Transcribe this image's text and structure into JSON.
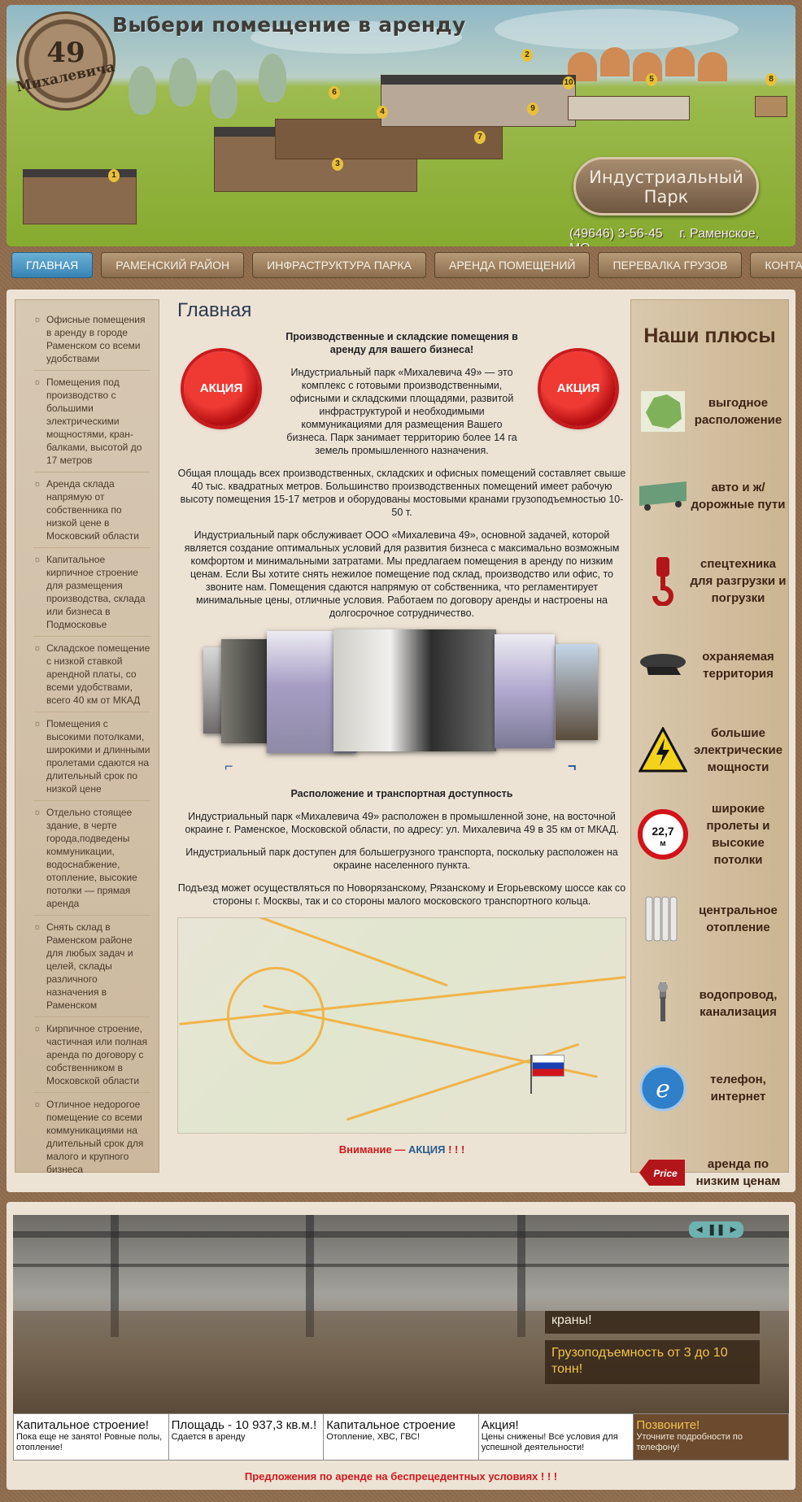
{
  "header": {
    "title": "Выбери помещение в аренду",
    "logo_number": "49",
    "logo_street": "Михалевича",
    "park_line1": "Индустриальный",
    "park_line2": "Парк",
    "phone": "(49646) 3-56-45",
    "city": "г. Раменское, МО",
    "pins": [
      "1",
      "2",
      "3",
      "4",
      "5",
      "6",
      "7",
      "8",
      "9",
      "10"
    ]
  },
  "nav": {
    "items": [
      {
        "label": "ГЛАВНАЯ",
        "active": true
      },
      {
        "label": "РАМЕНСКИЙ РАЙОН"
      },
      {
        "label": "ИНФРАСТРУКТУРА ПАРКА"
      },
      {
        "label": "АРЕНДА ПОМЕЩЕНИЙ"
      },
      {
        "label": "ПЕРЕВАЛКА ГРУЗОВ"
      },
      {
        "label": "КОНТАКТЫ"
      }
    ]
  },
  "sidebar": {
    "items": [
      "Офисные помещения в аренду в городе Раменском со всеми удобствами",
      "Помещения под производство с большими электрическими мощностями, кран-балками, высотой до 17 метров",
      "Аренда склада напрямую от собственника по низкой цене в Московский области",
      "Капитальное кирпичное строение для размещения производства, склада или бизнеса в Подмосковье",
      "Складское помещение с низкой ставкой арендной платы, со всеми удобствами, всего 40 км от МКАД",
      "Помещения с высокими потолками, широкими и длинными пролетами сдаются на длительный срок по низкой цене",
      "Отдельно стоящее здание, в черте города,подведены коммуникации, водоснабжение, отопление, высокие потолки — прямая аренда",
      "Снять склад в Раменском районе для любых задач и целей, склады различного назначения в Раменском",
      "Кирпичное строение, частичная или полная аренда по договору с собственником в Московской области",
      "Отличное недорогое помещение со всеми коммуникациями на длительный срок для малого и крупного бизнеса"
    ]
  },
  "main": {
    "title": "Главная",
    "stamp_label": "АКЦИЯ",
    "intro_heading": "Производственные и складские помещения в аренду для вашего бизнеса!",
    "intro_text": "Индустриальный парк «Михалевича 49» — это комплекс с готовыми производственными, офисными и складскими площадями, развитой инфраструктурой и необходимыми коммуникациями для размещения Вашего бизнеса. Парк занимает территорию  более 14 га земель промышленного назначения.",
    "para2": "Общая площадь всех производственных, складских и офисных помещений составляет свыше 40 тыс. квадратных метров. Большинство производственных помещений имеет рабочую высоту помещения 15-17 метров и оборудованы мостовыми кранами грузоподъемностью 10-50 т.",
    "para3": "Индустриальный парк обслуживает ООО «Михалевича 49», основной задачей, которой является создание оптимальных условий для развития бизнеса с максимально возможным комфортом и минимальными затратами. Мы предлагаем помещения в аренду по низким ценам. Если Вы хотите снять нежилое помещение под склад, производство или офис, то звоните нам. Помещения сдаются напрямую от собственника, что регламентирует минимальные цены, отличные условия. Работаем по договору аренды и настроены на долгосрочное сотрудничество.",
    "gallery_prev": "⌐",
    "gallery_next": "¬",
    "location_heading": "Расположение и транспортная доступность",
    "loc1": "Индустриальный парк «Михалевича 49» расположен в промышленной зоне, на восточной окраине г. Раменское, Московской области, по адресу: ул. Михалевича 49 в 35 км от МКАД.",
    "loc2": "Индустриальный парк доступен для большегрузного транспорта, поскольку расположен на окраине населенного пункта.",
    "loc3": "Подъезд может осуществляться по Новорязанскому, Рязанскому и Егорьевскому шоссе как со стороны г. Москвы, так и со стороны малого московского транспортного кольца.",
    "promo_a": "Внимание — ",
    "promo_b": "АКЦИЯ",
    "promo_c": " ! ! !"
  },
  "plus": {
    "title": "Наши плюсы",
    "items": [
      {
        "label": "выгодное расположение",
        "icon": "map-region-icon"
      },
      {
        "label": "авто и ж/дорожные пути",
        "icon": "railcar-icon"
      },
      {
        "label": "спецтехника для разгрузки и погрузки",
        "icon": "crane-hook-icon"
      },
      {
        "label": "охраняемая территория",
        "icon": "guard-cap-icon"
      },
      {
        "label": "большие электрические мощности",
        "icon": "high-voltage-icon"
      },
      {
        "label": "широкие пролеты и высокие потолки",
        "icon": "height-sign-icon",
        "sign_value": "22,7",
        "sign_unit": "м"
      },
      {
        "label": "центральное отопление",
        "icon": "radiator-icon"
      },
      {
        "label": "водопровод, канализация",
        "icon": "faucet-icon"
      },
      {
        "label": "телефон, интернет",
        "icon": "internet-icon"
      },
      {
        "label": "аренда по низким ценам",
        "icon": "price-tag-icon",
        "tag_text": "Price"
      }
    ]
  },
  "slider": {
    "controls": "◄ ❚❚ ►",
    "caption_title": "краны!",
    "caption_text": "Грузоподъемность от 3 до 10 тонн!",
    "tabs": [
      {
        "title": "Капитальное строение!",
        "sub": "Пока еще не занято! Ровные полы, отопление!"
      },
      {
        "title": "Площадь - 10 937,3 кв.м.!",
        "sub": "Сдается в аренду"
      },
      {
        "title": "Капитальное строение",
        "sub": "Отопление, ХВС, ГВС!"
      },
      {
        "title": "Акция!",
        "sub": "Цены снижены! Все условия для успешной деятельности!"
      },
      {
        "title": "Позвоните!",
        "sub": "Уточните подробности по телефону!"
      }
    ]
  },
  "footer": {
    "text": "Предложения по аренде на беспрецедентных условиях ! ! !"
  }
}
